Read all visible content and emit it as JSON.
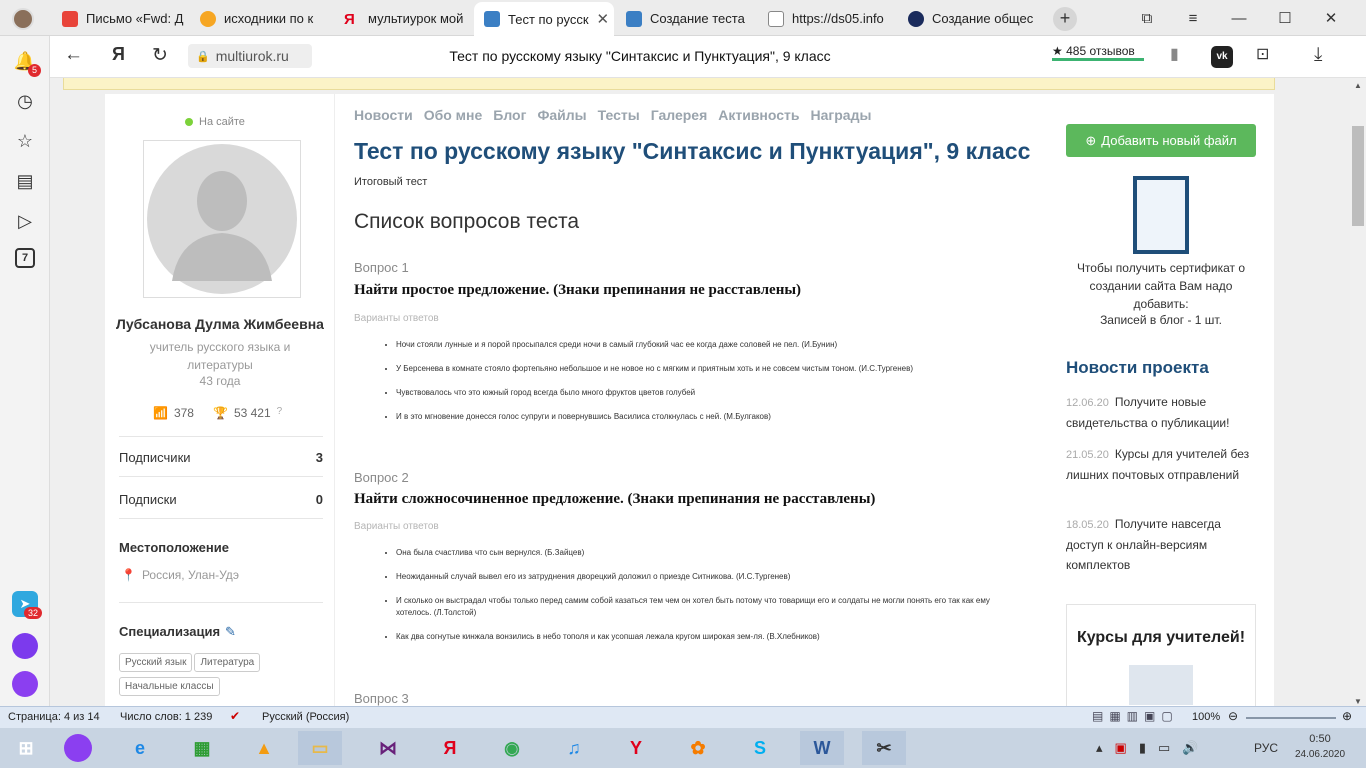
{
  "tabs": [
    {
      "label": "Письмо «Fwd: Д",
      "icon": "gmail-icon",
      "color": "#e8443a"
    },
    {
      "label": "исходники по к",
      "icon": "cloud-icon",
      "color": "#f6a623"
    },
    {
      "label": "мультиурок мой",
      "icon": "yandex-icon",
      "color": "#e0001b"
    },
    {
      "label": "Тест по русск",
      "icon": "book-icon",
      "color": "#3b7fc4"
    },
    {
      "label": "Создание теста",
      "icon": "book-icon",
      "color": "#3b7fc4"
    },
    {
      "label": "https://ds05.info",
      "icon": "page-icon",
      "color": "#888888"
    },
    {
      "label": "Создание общес",
      "icon": "hse-icon",
      "color": "#1a2b5c"
    }
  ],
  "address": {
    "domain": "multiurok.ru",
    "title": "Тест по русскому языку \"Синтаксис и Пунктуация\", 9 класс",
    "reviews": "★ 485 отзывов"
  },
  "sidebar_badges": {
    "notifications": "5",
    "tg": "32",
    "calendar_day": "7"
  },
  "profile": {
    "online": "На сайте",
    "name": "Лубсанова Дулма Жимбеевна",
    "role": "учитель русского языка и литературы",
    "age": "43 года",
    "rating": "378",
    "points": "53 421",
    "subscribers_label": "Подписчики",
    "subscribers_value": "3",
    "subscriptions_label": "Подписки",
    "subscriptions_value": "0",
    "location_title": "Местоположение",
    "location": "Россия, Улан-Удэ",
    "spec_title": "Специализация",
    "tags": [
      "Русский язык",
      "Литература",
      "Начальные классы"
    ]
  },
  "menu": [
    "Новости",
    "Обо мне",
    "Блог",
    "Файлы",
    "Тесты",
    "Галерея",
    "Активность",
    "Награды"
  ],
  "main": {
    "title": "Тест по русскому языку \"Синтаксис и Пунктуация\", 9 класс",
    "subtitle": "Итоговый тест",
    "list_title": "Список вопросов теста",
    "answers_label": "Варианты ответов",
    "questions": [
      {
        "label": "Вопрос 1",
        "text": "Найти простое предложение. (Знаки препинания не расставлены)",
        "answers": [
          "Ночи стояли лунные и я порой просыпался среди ночи в самый глубокий час ее когда даже соловей не пел. (И.Бунин)",
          "У Берсенева в комнате стояло фортепьяно небольшое и не новое но с мягким и приятным хоть и не совсем чистым тоном. (И.С.Тургенев)",
          "Чувствовалось что это южный город всегда было много фруктов цветов голубей",
          "И в это мгновение донесся голос супруги и повернувшись Василиса столкнулась с ней. (М.Булгаков)"
        ]
      },
      {
        "label": "Вопрос 2",
        "text": "Найти сложносочиненное предложение. (Знаки препинания не расставлены)",
        "answers": [
          "Она была счастлива что сын вернулся. (Б.Зайцев)",
          "Неожиданный случай вывел его из затруднения дворецкий доложил о приезде Ситникова. (И.С.Тургенев)",
          "И сколько он выстрадал чтобы только перед самим собой казаться тем чем он хотел быть потому что товарищи его и солдаты не могли понять его так как ему хотелось. (Л.Толстой)",
          "Как два согнутые кинжала вонзились в небо тополя и как усопшая лежала кругом широкая зем-ля. (В.Хлебников)"
        ]
      },
      {
        "label": "Вопрос 3"
      }
    ]
  },
  "right": {
    "add_button": "Добавить новый файл",
    "cert_text": "Чтобы получить сертификат о создании сайта Вам надо добавить:",
    "cert_req": "Записей в блог - 1 шт.",
    "news_title": "Новости проекта",
    "news": [
      {
        "date": "12.06.20",
        "text": "Получите новые свидетельства о публикации!"
      },
      {
        "date": "21.05.20",
        "text": "Курсы для учителей без лишних почтовых отправлений"
      },
      {
        "date": "18.05.20",
        "text": "Получите навсегда доступ к онлайн-версиям комплектов"
      }
    ],
    "courses_title": "Курсы для учителей!"
  },
  "statusbar": {
    "page": "Страница: 4 из 14",
    "words": "Число слов: 1 239",
    "lang": "Русский (Россия)",
    "zoom": "100%"
  },
  "tray": {
    "lang": "РУС",
    "time": "0:50",
    "date": "24.06.2020"
  }
}
